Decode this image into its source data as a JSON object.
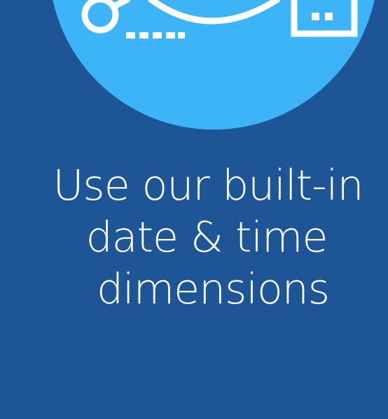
{
  "caption": {
    "line1": "Use our built-in",
    "line2": "date & time",
    "line3": "dimensions"
  },
  "illustration": {
    "icons": [
      "key-icon",
      "calendar-icon"
    ],
    "circle_color": "#3db4f8",
    "background_color": "#1d5597",
    "stroke_color": "#ffffff"
  }
}
